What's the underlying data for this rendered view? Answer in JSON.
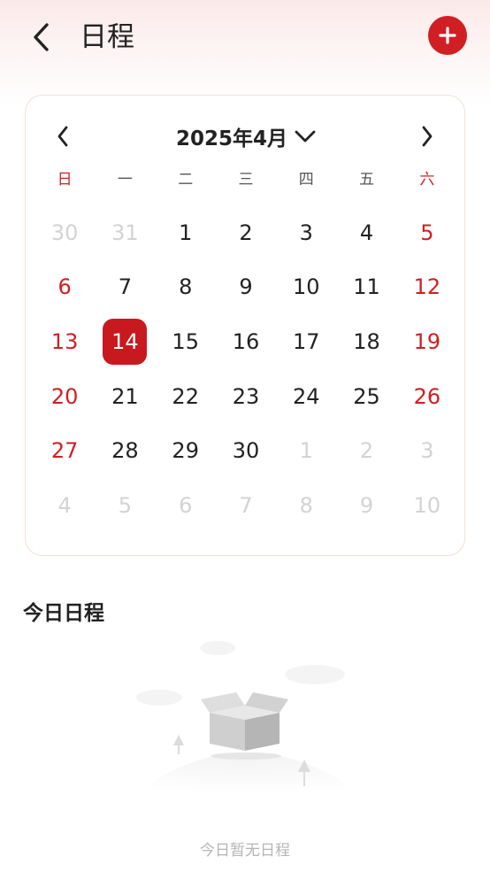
{
  "header": {
    "title": "日程",
    "back_icon": "chevron-left-icon",
    "add_icon": "plus-icon",
    "accent_color": "#cf1f24"
  },
  "calendar": {
    "month_label": "2025年4月",
    "weekdays": [
      "日",
      "一",
      "二",
      "三",
      "四",
      "五",
      "六"
    ],
    "days": [
      {
        "d": "30",
        "t": "other"
      },
      {
        "d": "31",
        "t": "other"
      },
      {
        "d": "1",
        "t": "normal"
      },
      {
        "d": "2",
        "t": "normal"
      },
      {
        "d": "3",
        "t": "normal"
      },
      {
        "d": "4",
        "t": "normal"
      },
      {
        "d": "5",
        "t": "weekend"
      },
      {
        "d": "6",
        "t": "weekend"
      },
      {
        "d": "7",
        "t": "normal"
      },
      {
        "d": "8",
        "t": "normal"
      },
      {
        "d": "9",
        "t": "normal"
      },
      {
        "d": "10",
        "t": "normal"
      },
      {
        "d": "11",
        "t": "normal"
      },
      {
        "d": "12",
        "t": "weekend"
      },
      {
        "d": "13",
        "t": "weekend"
      },
      {
        "d": "14",
        "t": "selected"
      },
      {
        "d": "15",
        "t": "normal"
      },
      {
        "d": "16",
        "t": "normal"
      },
      {
        "d": "17",
        "t": "normal"
      },
      {
        "d": "18",
        "t": "normal"
      },
      {
        "d": "19",
        "t": "weekend"
      },
      {
        "d": "20",
        "t": "weekend"
      },
      {
        "d": "21",
        "t": "normal"
      },
      {
        "d": "22",
        "t": "normal"
      },
      {
        "d": "23",
        "t": "normal"
      },
      {
        "d": "24",
        "t": "normal"
      },
      {
        "d": "25",
        "t": "normal"
      },
      {
        "d": "26",
        "t": "weekend"
      },
      {
        "d": "27",
        "t": "weekend"
      },
      {
        "d": "28",
        "t": "normal"
      },
      {
        "d": "29",
        "t": "normal"
      },
      {
        "d": "30",
        "t": "normal"
      },
      {
        "d": "1",
        "t": "other"
      },
      {
        "d": "2",
        "t": "other"
      },
      {
        "d": "3",
        "t": "other"
      },
      {
        "d": "4",
        "t": "other"
      },
      {
        "d": "5",
        "t": "other"
      },
      {
        "d": "6",
        "t": "other"
      },
      {
        "d": "7",
        "t": "other"
      },
      {
        "d": "8",
        "t": "other"
      },
      {
        "d": "9",
        "t": "other"
      },
      {
        "d": "10",
        "t": "other"
      }
    ]
  },
  "today": {
    "title": "今日日程",
    "empty_text": "今日暂无日程",
    "empty_icon": "empty-box-icon"
  }
}
